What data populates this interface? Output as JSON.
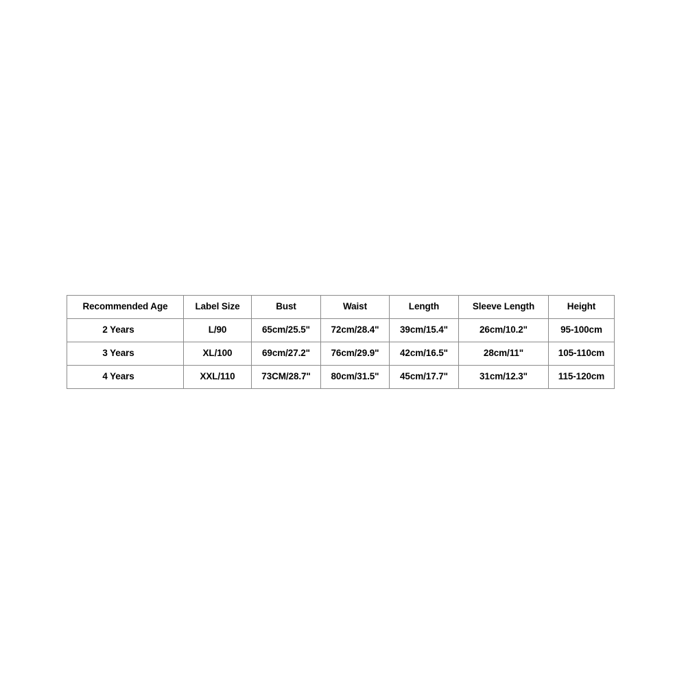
{
  "chart_data": {
    "type": "table",
    "title": "",
    "columns": [
      "Recommended Age",
      "Label Size",
      "Bust",
      "Waist",
      "Length",
      "Sleeve Length",
      "Height"
    ],
    "rows": [
      {
        "recommended_age": "2 Years",
        "label_size": "L/90",
        "bust": "65cm/25.5\"",
        "waist": "72cm/28.4\"",
        "length": "39cm/15.4\"",
        "sleeve_length": "26cm/10.2\"",
        "height": "95-100cm"
      },
      {
        "recommended_age": "3 Years",
        "label_size": "XL/100",
        "bust": "69cm/27.2\"",
        "waist": "76cm/29.9\"",
        "length": "42cm/16.5\"",
        "sleeve_length": "28cm/11\"",
        "height": "105-110cm"
      },
      {
        "recommended_age": "4 Years",
        "label_size": "XXL/110",
        "bust": "73CM/28.7\"",
        "waist": "80cm/31.5\"",
        "length": "45cm/17.7\"",
        "sleeve_length": "31cm/12.3\"",
        "height": "115-120cm"
      }
    ]
  },
  "table": {
    "headers": {
      "recommended_age": "Recommended Age",
      "label_size": "Label Size",
      "bust": "Bust",
      "waist": "Waist",
      "length": "Length",
      "sleeve_length": "Sleeve Length",
      "height": "Height"
    },
    "rows": [
      {
        "recommended_age": "2 Years",
        "label_size": "L/90",
        "bust": "65cm/25.5\"",
        "waist": "72cm/28.4\"",
        "length": "39cm/15.4\"",
        "sleeve_length": "26cm/10.2\"",
        "height": "95-100cm"
      },
      {
        "recommended_age": "3 Years",
        "label_size": "XL/100",
        "bust": "69cm/27.2\"",
        "waist": "76cm/29.9\"",
        "length": "42cm/16.5\"",
        "sleeve_length": "28cm/11\"",
        "height": "105-110cm"
      },
      {
        "recommended_age": "4 Years",
        "label_size": "XXL/110",
        "bust": "73CM/28.7\"",
        "waist": "80cm/31.5\"",
        "length": "45cm/17.7\"",
        "sleeve_length": "31cm/12.3\"",
        "height": "115-120cm"
      }
    ]
  },
  "colors": {
    "background": "#ffffff",
    "border": "#8a8a8a",
    "text": "#000000"
  }
}
